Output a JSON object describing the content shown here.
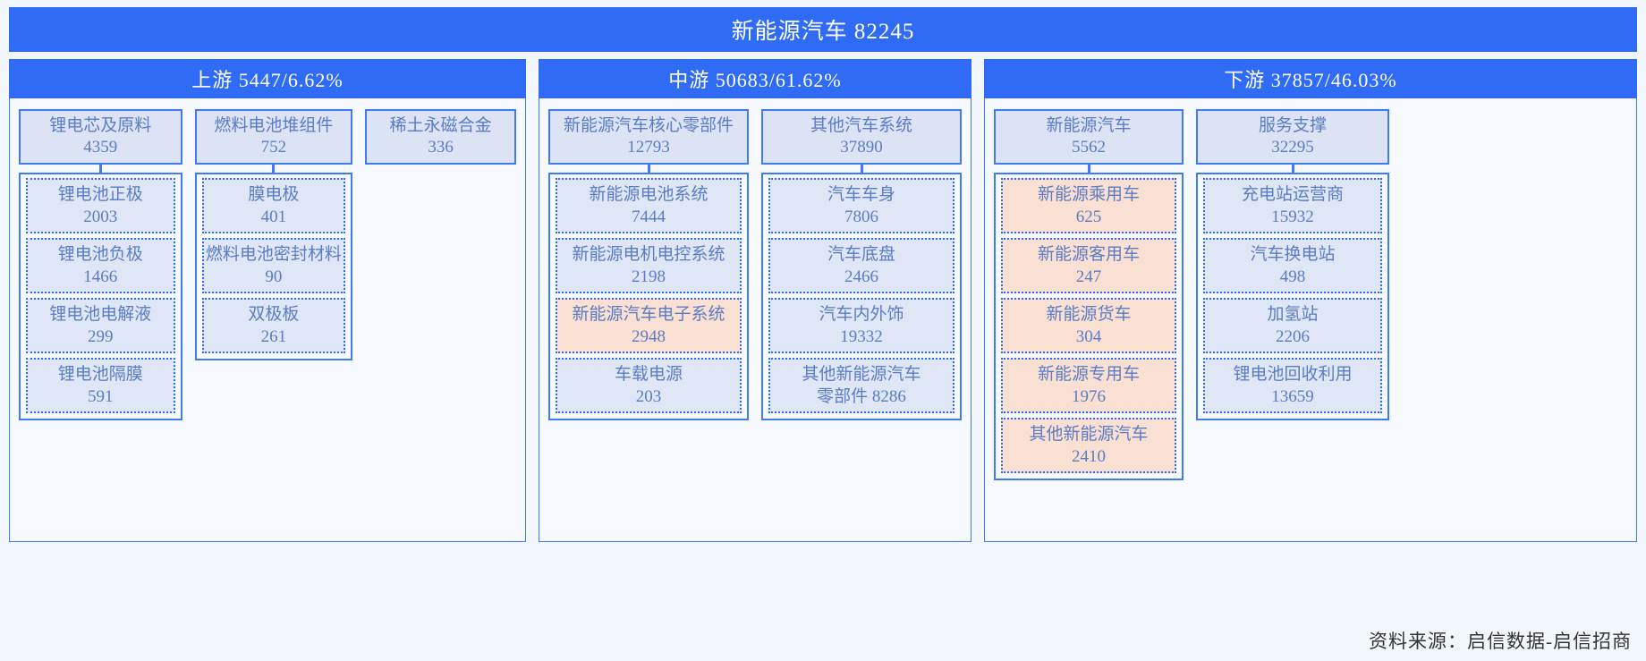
{
  "root": {
    "label": "新能源汽车",
    "value": "82245",
    "text": "新能源汽车  82245"
  },
  "footer": {
    "source": "资料来源：启信数据-启信招商"
  },
  "colors": {
    "banner": "#2f6bf5",
    "group_fill": "#dbe3f4",
    "leaf_fill": "#dfe6f6",
    "leaf_highlight": "#fae0d2",
    "border": "#3f7bf7",
    "text": "#5b7cc4",
    "page_bg": "#f2f6fd"
  },
  "tiers": [
    {
      "id": "upstream",
      "header": "上游  5447/6.62%",
      "name": "上游",
      "value": "5447",
      "share": "6.62%",
      "groups": [
        {
          "name": "锂电芯及原料",
          "value": "4359",
          "children": [
            {
              "name": "锂电池正极",
              "value": "2003",
              "highlight": false
            },
            {
              "name": "锂电池负极",
              "value": "1466",
              "highlight": false
            },
            {
              "name": "锂电池电解液",
              "value": "299",
              "highlight": false
            },
            {
              "name": "锂电池隔膜",
              "value": "591",
              "highlight": false
            }
          ]
        },
        {
          "name": "燃料电池堆组件",
          "value": "752",
          "children": [
            {
              "name": "膜电极",
              "value": "401",
              "highlight": false
            },
            {
              "name": "燃料电池密封材料",
              "value": "90",
              "highlight": false
            },
            {
              "name": "双极板",
              "value": "261",
              "highlight": false
            }
          ]
        },
        {
          "name": "稀土永磁合金",
          "value": "336",
          "children": []
        }
      ]
    },
    {
      "id": "midstream",
      "header": "中游  50683/61.62%",
      "name": "中游",
      "value": "50683",
      "share": "61.62%",
      "groups": [
        {
          "name": "新能源汽车核心零部件",
          "value": "12793",
          "children": [
            {
              "name": "新能源电池系统",
              "value": "7444",
              "highlight": false
            },
            {
              "name": "新能源电机电控系统",
              "value": "2198",
              "highlight": false
            },
            {
              "name": "新能源汽车电子系统",
              "value": "2948",
              "highlight": true
            },
            {
              "name": "车载电源",
              "value": "203",
              "highlight": false
            }
          ]
        },
        {
          "name": "其他汽车系统",
          "value": "37890",
          "children": [
            {
              "name": "汽车车身",
              "value": "7806",
              "highlight": false
            },
            {
              "name": "汽车底盘",
              "value": "2466",
              "highlight": false
            },
            {
              "name": "汽车内外饰",
              "value": "19332",
              "highlight": false
            },
            {
              "name": "其他新能源汽车",
              "value": "零部件  8286",
              "highlight": false
            }
          ]
        }
      ]
    },
    {
      "id": "downstream",
      "header": "下游  37857/46.03%",
      "name": "下游",
      "value": "37857",
      "share": "46.03%",
      "groups": [
        {
          "name": "新能源汽车",
          "value": "5562",
          "children": [
            {
              "name": "新能源乘用车",
              "value": "625",
              "highlight": true
            },
            {
              "name": "新能源客用车",
              "value": "247",
              "highlight": true
            },
            {
              "name": "新能源货车",
              "value": "304",
              "highlight": true
            },
            {
              "name": "新能源专用车",
              "value": "1976",
              "highlight": true
            },
            {
              "name": "其他新能源汽车",
              "value": "2410",
              "highlight": true
            }
          ]
        },
        {
          "name": "服务支撑",
          "value": "32295",
          "children": [
            {
              "name": "充电站运营商",
              "value": "15932",
              "highlight": false
            },
            {
              "name": "汽车换电站",
              "value": "498",
              "highlight": false
            },
            {
              "name": "加氢站",
              "value": "2206",
              "highlight": false
            },
            {
              "name": "锂电池回收利用",
              "value": "13659",
              "highlight": false
            }
          ]
        }
      ]
    }
  ]
}
